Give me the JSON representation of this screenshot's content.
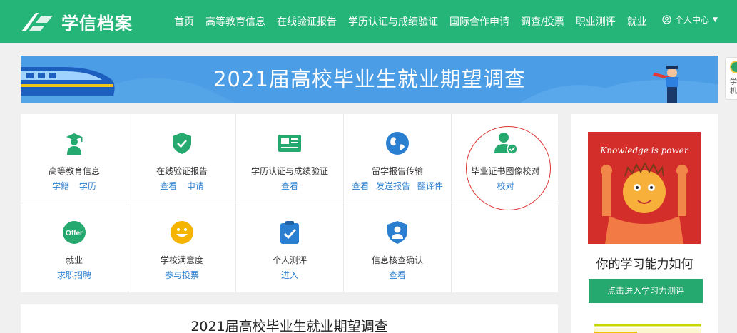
{
  "header": {
    "logo_text": "学信档案",
    "nav": [
      "首页",
      "高等教育信息",
      "在线验证报告",
      "学历认证与成绩验证",
      "国际合作申请",
      "调查/投票",
      "职业测评",
      "就业"
    ],
    "user_center": "个人中心"
  },
  "banner": {
    "title": "2021届高校毕业生就业期望调查"
  },
  "side_float": {
    "text_line1": "学",
    "text_line2": "机"
  },
  "services": [
    {
      "name": "高等教育信息",
      "links": [
        "学籍",
        "学历"
      ],
      "icon": "graduate-icon",
      "color": "#25a96f"
    },
    {
      "name": "在线验证报告",
      "links": [
        "查看",
        "申请"
      ],
      "icon": "shield-check-icon",
      "color": "#25a96f"
    },
    {
      "name": "学历认证与成绩验证",
      "links": [
        "查看"
      ],
      "icon": "id-card-icon",
      "color": "#25a96f"
    },
    {
      "name": "留学报告传输",
      "links": [
        "查看",
        "发送报告",
        "翻译件"
      ],
      "icon": "globe-icon",
      "color": "#2a7fd0"
    },
    {
      "name": "毕业证书图像校对",
      "links": [
        "校对"
      ],
      "icon": "user-check-icon",
      "color": "#25a96f"
    },
    {
      "name": "就业",
      "links": [
        "求职招聘"
      ],
      "icon": "offer-icon",
      "color": "#25a96f",
      "badge": "Offer"
    },
    {
      "name": "学校满意度",
      "links": [
        "参与投票"
      ],
      "icon": "smiley-icon",
      "color": "#f5b400"
    },
    {
      "name": "个人测评",
      "links": [
        "进入"
      ],
      "icon": "clipboard-check-icon",
      "color": "#2a7fd0"
    },
    {
      "name": "信息核查确认",
      "links": [
        "查看"
      ],
      "icon": "user-shield-icon",
      "color": "#2a7fd0"
    }
  ],
  "survey_card": {
    "title": "2021届高校毕业生就业期望调查"
  },
  "right_panel": {
    "image_caption": "Knowledge is power",
    "title": "你的学习能力如何",
    "button": "点击进入学习力测评"
  },
  "colors": {
    "brand_green": "#25b579",
    "banner_blue": "#4b9de6",
    "link_blue": "#2a7fd0",
    "annotation_red": "#d33"
  }
}
